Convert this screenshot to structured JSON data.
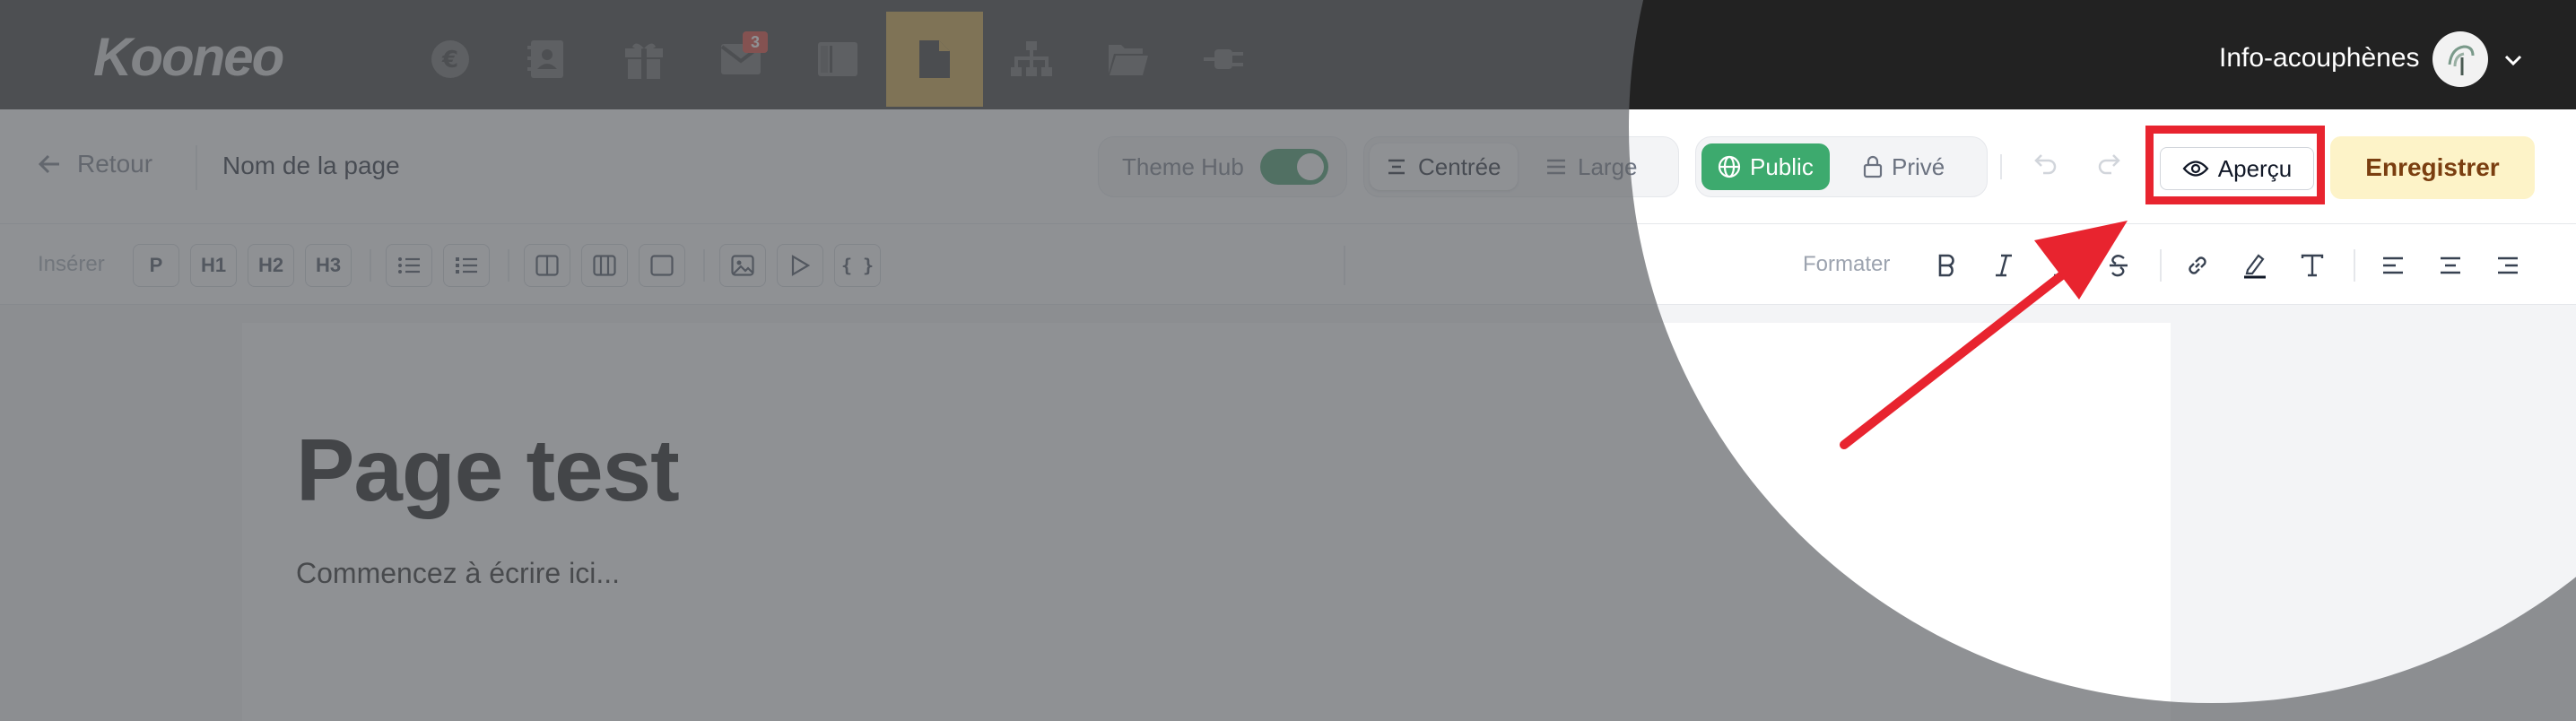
{
  "app": {
    "logo": "Kooneo",
    "account_name": "Info-acouphènes",
    "nav": [
      {
        "icon": "euro-icon"
      },
      {
        "icon": "contacts-book-icon"
      },
      {
        "icon": "gift-box-icon"
      },
      {
        "icon": "mail-icon",
        "badge": "3"
      },
      {
        "icon": "columns-layout-icon"
      },
      {
        "icon": "page-document-icon",
        "active": true
      },
      {
        "icon": "sitemap-icon"
      },
      {
        "icon": "folder-open-icon"
      },
      {
        "icon": "plug-icon"
      }
    ],
    "colors": {
      "topbar": "#222222",
      "active_nav": "#c99a30",
      "badge": "#d92d20"
    }
  },
  "toolbar": {
    "back_label": "Retour",
    "page_name": "Nom de la page",
    "theme_hub_label": "Theme Hub",
    "theme_hub_enabled": true,
    "width_options": [
      {
        "label": "Centrée",
        "selected": true
      },
      {
        "label": "Large",
        "selected": false
      }
    ],
    "visibility_options": [
      {
        "label": "Public",
        "selected": true
      },
      {
        "label": "Privé",
        "selected": false
      }
    ],
    "preview_label": "Aperçu",
    "save_label": "Enregistrer",
    "colors": {
      "public": "#3daa6e",
      "save_bg": "#fdf3c8",
      "save_text": "#7a3e10",
      "highlight": "#e8242f"
    }
  },
  "formatbar": {
    "insert_label": "Insérer",
    "insert_buttons": [
      "P",
      "H1",
      "H2",
      "H3"
    ],
    "insert_icons": [
      "bullet-list-icon",
      "numbered-list-icon",
      "two-columns-icon",
      "three-columns-icon",
      "box-icon",
      "image-icon",
      "video-play-icon",
      "code-braces-icon"
    ],
    "code_glyph": "{ }",
    "format_label": "Formater",
    "format_icons": [
      "bold-icon",
      "italic-icon",
      "underline-icon",
      "strikethrough-icon",
      "link-icon",
      "highlight-pen-icon",
      "text-type-icon",
      "align-left-icon",
      "align-center-icon",
      "align-right-icon"
    ]
  },
  "editor": {
    "title": "Page test",
    "body": "Commencez à écrire ici..."
  }
}
